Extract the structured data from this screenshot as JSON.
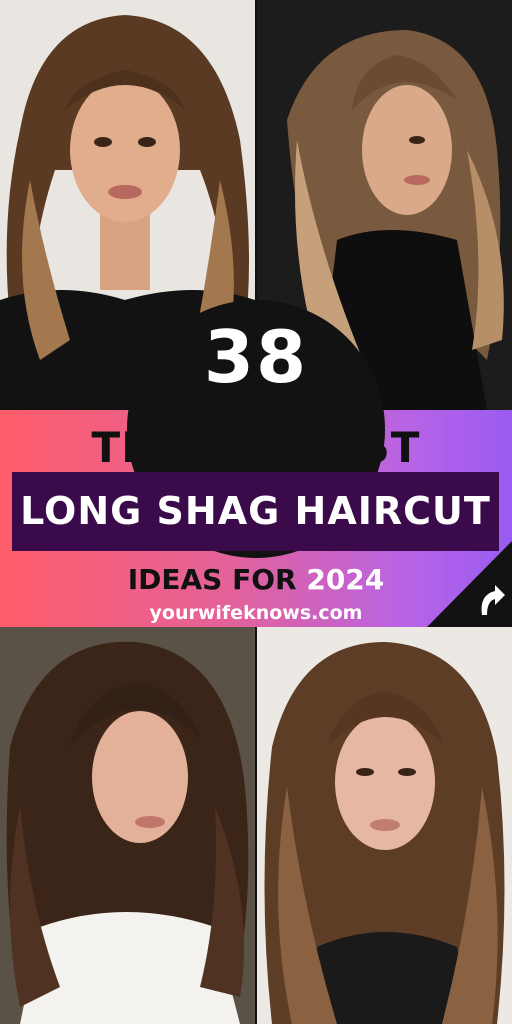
{
  "headline": {
    "number": "38",
    "line1": "THE CUTTEST",
    "line2": "LONG SHAG HAIRCUT",
    "line3_text": "IDEAS FOR",
    "line3_year": "2024"
  },
  "website": "yourwifeknows.com",
  "icons": {
    "corner": "share-arrow-icon"
  },
  "colors": {
    "gradient_start": "#ff5d6a",
    "gradient_end": "#9a5cf2",
    "circle": "#121212",
    "title_box": "#3a0a4a",
    "title_text_dark": "#111111",
    "title_text_light": "#ffffff"
  }
}
